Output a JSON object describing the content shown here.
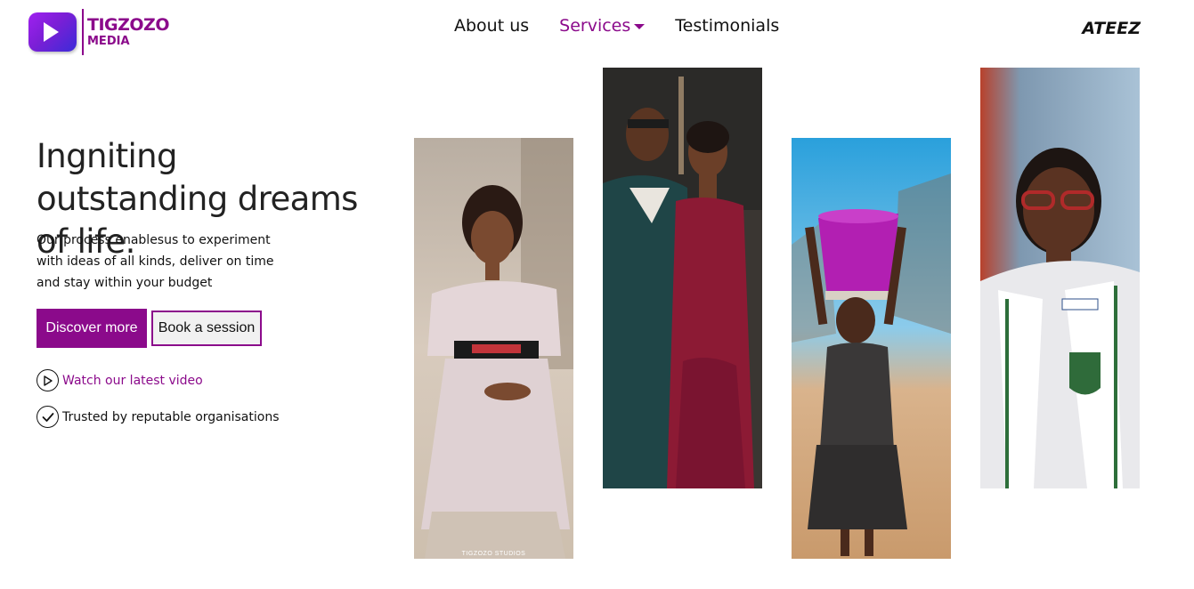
{
  "header": {
    "logo": {
      "line1": "TIGZOZO",
      "line2": "MEDIA"
    },
    "nav": [
      {
        "label": "About us"
      },
      {
        "label": "Services"
      },
      {
        "label": "Testimonials"
      }
    ],
    "brand_right": "ATEEZ"
  },
  "hero": {
    "headline": "Ingniting outstanding dreams of life.",
    "subtext": "Our process enablesus to experiment with ideas of all kinds, deliver on time and stay within your budget",
    "primary_button": "Discover more",
    "secondary_button": "Book a session",
    "video_link": "Watch our latest video",
    "trust_text": "Trusted by reputable organisations"
  },
  "gallery": {
    "caption": "TIGZOZO STUDIOS"
  },
  "colors": {
    "accent": "#8b0a8b",
    "text": "#111111",
    "secondary_button_bg": "#f1f1f1"
  },
  "icons": {
    "play": "play-circle-icon",
    "check": "check-circle-icon",
    "caret": "caret-down-icon"
  }
}
